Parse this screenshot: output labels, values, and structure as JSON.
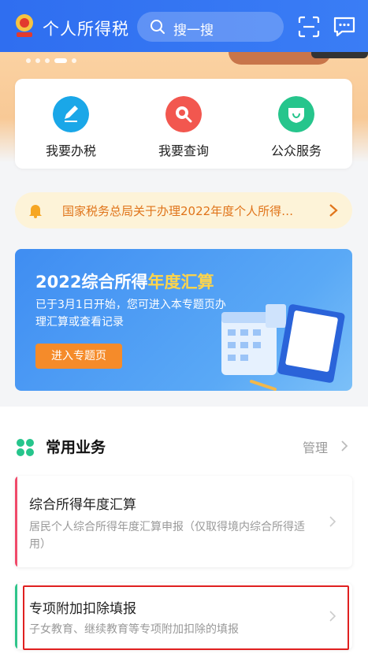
{
  "header": {
    "title": "个人所得税",
    "search_placeholder": "搜一搜"
  },
  "quick_actions": [
    {
      "label": "我要办税",
      "icon": "pen-icon",
      "color": "#1aa7e8"
    },
    {
      "label": "我要查询",
      "icon": "search-icon",
      "color": "#f2574f"
    },
    {
      "label": "公众服务",
      "icon": "shield-icon",
      "color": "#26c58c"
    }
  ],
  "notice": {
    "text": "国家税务总局关于办理2022年度个人所得…"
  },
  "promo": {
    "title_main": "2022综合所得",
    "title_highlight": "年度汇算",
    "desc": "已于3月1日开始，您可进入本专题页办理汇算或查看记录",
    "button": "进入专题页"
  },
  "section": {
    "title": "常用业务",
    "manage": "管理"
  },
  "cards": [
    {
      "title": "综合所得年度汇算",
      "desc": "居民个人综合所得年度汇算申报（仅取得境内综合所得适用）",
      "accent": "#f04a6a"
    },
    {
      "title": "专项附加扣除填报",
      "desc": "子女教育、继续教育等专项附加扣除的填报",
      "accent": "#2fc48a"
    }
  ]
}
